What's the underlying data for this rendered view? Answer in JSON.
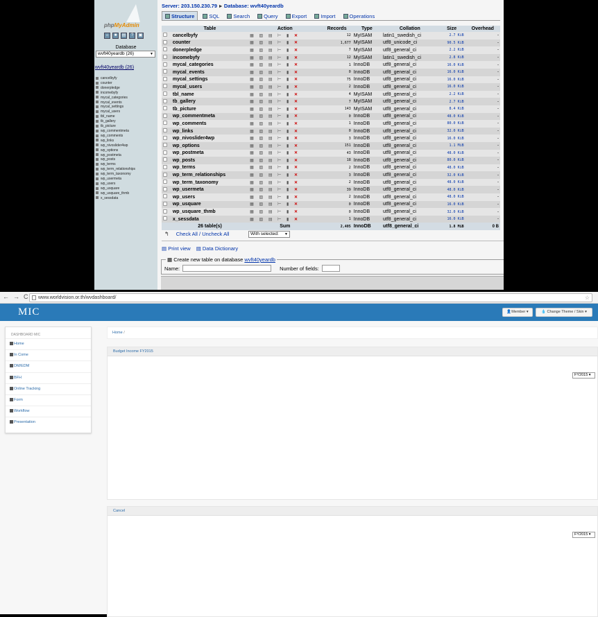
{
  "pma": {
    "logo": {
      "php": "php",
      "myadmin": "MyAdmin"
    },
    "nav_icons": [
      "⌂",
      "■",
      "▤",
      "?",
      "▣"
    ],
    "db_label": "Database",
    "db_select": "wvft40yeardb (26)",
    "db_link": "wvft40yeardb (26)",
    "server_label": "Server: 203.150.230.79",
    "database_label": "Database: wvft40yeardb",
    "tabs": [
      {
        "label": "Structure",
        "active": true
      },
      {
        "label": "SQL"
      },
      {
        "label": "Search"
      },
      {
        "label": "Query"
      },
      {
        "label": "Export"
      },
      {
        "label": "Import"
      },
      {
        "label": "Operations"
      }
    ],
    "headers": [
      "Table",
      "Action",
      "Records",
      "Type",
      "Collation",
      "Size",
      "Overhead"
    ],
    "rows": [
      [
        "cancelbyfy",
        "12",
        "MyISAM",
        "latin1_swedish_ci",
        "2.7 KiB",
        "-"
      ],
      [
        "counter",
        "1,677",
        "MyISAM",
        "utf8_unicode_ci",
        "90.5 KiB",
        "-"
      ],
      [
        "donerpledge",
        "7",
        "MyISAM",
        "utf8_general_ci",
        "2.2 KiB",
        "-"
      ],
      [
        "incomebyfy",
        "12",
        "MyISAM",
        "latin1_swedish_ci",
        "2.8 KiB",
        "-"
      ],
      [
        "mycal_categories",
        "1",
        "InnoDB",
        "utf8_general_ci",
        "16.0 KiB",
        "-"
      ],
      [
        "mycal_events",
        "0",
        "InnoDB",
        "utf8_general_ci",
        "16.0 KiB",
        "-"
      ],
      [
        "mycal_settings",
        "75",
        "InnoDB",
        "utf8_general_ci",
        "16.0 KiB",
        "-"
      ],
      [
        "mycal_users",
        "2",
        "InnoDB",
        "utf8_general_ci",
        "16.0 KiB",
        "-"
      ],
      [
        "tbl_name",
        "4",
        "MyISAM",
        "utf8_general_ci",
        "2.2 KiB",
        "-"
      ],
      [
        "tb_gallery",
        "7",
        "MyISAM",
        "utf8_general_ci",
        "2.7 KiB",
        "-"
      ],
      [
        "tb_picture",
        "143",
        "MyISAM",
        "utf8_general_ci",
        "8.4 KiB",
        "-"
      ],
      [
        "wp_commentmeta",
        "0",
        "InnoDB",
        "utf8_general_ci",
        "48.0 KiB",
        "-"
      ],
      [
        "wp_comments",
        "1",
        "InnoDB",
        "utf8_general_ci",
        "80.0 KiB",
        "-"
      ],
      [
        "wp_links",
        "0",
        "InnoDB",
        "utf8_general_ci",
        "32.0 KiB",
        "-"
      ],
      [
        "wp_nivoslider4wp",
        "3",
        "InnoDB",
        "utf8_general_ci",
        "16.0 KiB",
        "-"
      ],
      [
        "wp_options",
        "151",
        "InnoDB",
        "utf8_general_ci",
        "1.1 MiB",
        "-"
      ],
      [
        "wp_postmeta",
        "43",
        "InnoDB",
        "utf8_general_ci",
        "48.0 KiB",
        "-"
      ],
      [
        "wp_posts",
        "18",
        "InnoDB",
        "utf8_general_ci",
        "80.0 KiB",
        "-"
      ],
      [
        "wp_terms",
        "2",
        "InnoDB",
        "utf8_general_ci",
        "48.0 KiB",
        "-"
      ],
      [
        "wp_term_relationships",
        "3",
        "InnoDB",
        "utf8_general_ci",
        "32.0 KiB",
        "-"
      ],
      [
        "wp_term_taxonomy",
        "2",
        "InnoDB",
        "utf8_general_ci",
        "48.0 KiB",
        "-"
      ],
      [
        "wp_usermeta",
        "39",
        "InnoDB",
        "utf8_general_ci",
        "48.0 KiB",
        "-"
      ],
      [
        "wp_users",
        "2",
        "InnoDB",
        "utf8_general_ci",
        "48.0 KiB",
        "-"
      ],
      [
        "wp_usquare",
        "0",
        "InnoDB",
        "utf8_general_ci",
        "16.0 KiB",
        "-"
      ],
      [
        "wp_usquare_thmb",
        "0",
        "InnoDB",
        "utf8_general_ci",
        "32.0 KiB",
        "-"
      ],
      [
        "x_sessdata",
        "1",
        "InnoDB",
        "utf8_general_ci",
        "16.0 KiB",
        "-"
      ]
    ],
    "sum_row": {
      "tables": "26 table(s)",
      "label": "Sum",
      "records": "2,405",
      "type": "InnoDB",
      "collation": "utf8_general_ci",
      "size": "1.8 MiB",
      "overhead": "0 B"
    },
    "action_glyphs": "▦ ▨ ▤ ⊢ ▮",
    "delete_glyph": "✕",
    "check_all": "Check All / Uncheck All",
    "with_selected": "With selected:",
    "print_view": "Print view",
    "data_dictionary": "Data Dictionary",
    "create_table_prefix": "Create new table on database",
    "create_table_db": "wvft40yeardb",
    "name_label": "Name:",
    "fields_label": "Number of fields:"
  },
  "browser": {
    "nav": [
      "←",
      "→",
      "C"
    ],
    "url": "www.worldvision.or.th/wvdashboard/",
    "star": "☆"
  },
  "mic": {
    "brand": "MIC",
    "member_btn": "Member ▾",
    "theme_btn": "Change Theme / Skin ▾",
    "sidebar_title": "DASHBOARD MIC",
    "menu": [
      "Home",
      "In Come",
      "DM/EDM",
      "BFH",
      "Online Tracking",
      "Form",
      "Workflow",
      "Presentation"
    ],
    "breadcrumb": "Home",
    "breadcrumb_sep": "/",
    "panel1_title": "Budget Income FY2015",
    "panel1_select": "FY2015 ▾",
    "panel2_title": "Cancel",
    "panel2_select": "FY2015 ▾"
  }
}
